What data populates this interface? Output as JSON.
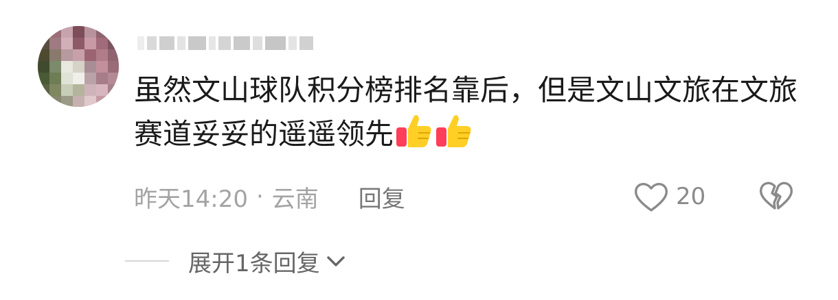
{
  "comment": {
    "username_obscured": true,
    "text": "虽然文山球队积分榜排名靠后，但是文山文旅在文旅赛道妥妥的遥遥领先",
    "emojis": [
      "thumbs-up",
      "thumbs-up"
    ],
    "time": "昨天14:20",
    "separator": "·",
    "location": "云南",
    "reply_label": "回复",
    "like_count": "20",
    "expand_label": "展开1条回复"
  },
  "icons": {
    "like": "heart-outline-icon",
    "dislike": "broken-heart-icon",
    "expand": "chevron-down-icon"
  },
  "colors": {
    "text": "#1a1a1a",
    "meta": "#a3a3a3",
    "secondary": "#777777"
  }
}
